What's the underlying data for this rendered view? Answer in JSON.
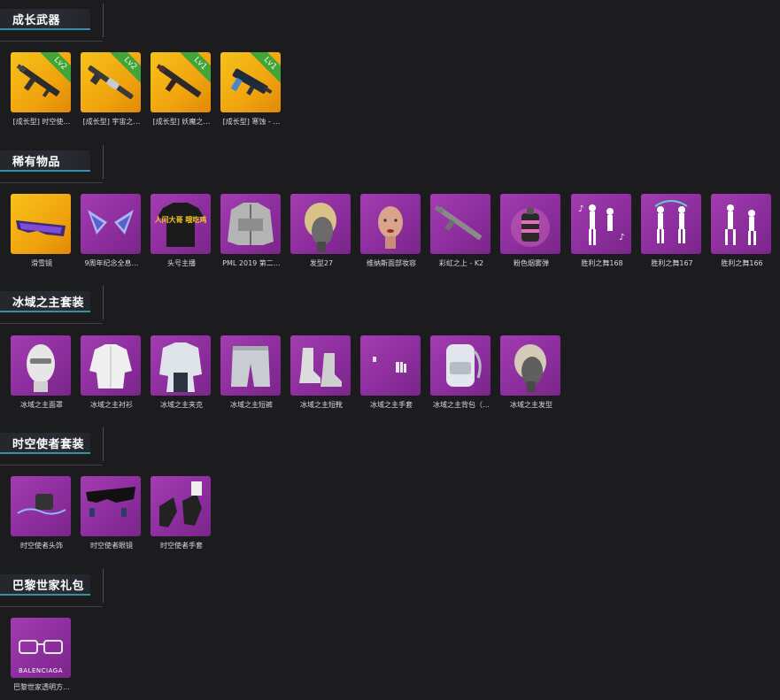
{
  "sections": [
    {
      "title": "成长武器"
    },
    {
      "title": "稀有物品"
    },
    {
      "title": "冰域之主套装"
    },
    {
      "title": "时空使者套装"
    },
    {
      "title": "巴黎世家礼包"
    }
  ],
  "growth_weapons": [
    {
      "name": "[成长型] 时空使…",
      "level": "Lv2",
      "icon": "rifle-icon"
    },
    {
      "name": "[成长型] 宇宙之…",
      "level": "Lv2",
      "icon": "shotgun-icon"
    },
    {
      "name": "[成长型] 妖魔之…",
      "level": "Lv1",
      "icon": "rifle-icon"
    },
    {
      "name": "[成长型] 寒蚀 - …",
      "level": "Lv1",
      "icon": "smg-icon"
    }
  ],
  "rare_items": [
    {
      "name": "滑雪镜",
      "icon": "goggles-icon",
      "rarity": "gold"
    },
    {
      "name": "9周年纪念全息…",
      "icon": "cat-ears-icon",
      "rarity": "purple"
    },
    {
      "name": "头号主播",
      "icon": "tshirt-icon",
      "rarity": "purple",
      "print": "人间大哥 哦吃鸡"
    },
    {
      "name": "PML 2019 第二…",
      "icon": "jacket-icon",
      "rarity": "purple"
    },
    {
      "name": "发型27",
      "icon": "hair-icon",
      "rarity": "purple"
    },
    {
      "name": "维纳斯面部妆容",
      "icon": "face-icon",
      "rarity": "purple"
    },
    {
      "name": "彩虹之上 - K2",
      "icon": "rifle-icon",
      "rarity": "purple"
    },
    {
      "name": "粉色烟雾弹",
      "icon": "grenade-icon",
      "rarity": "purple"
    },
    {
      "name": "胜利之舞168",
      "icon": "dance-icon",
      "rarity": "purple"
    },
    {
      "name": "胜利之舞167",
      "icon": "dance-icon",
      "rarity": "purple"
    },
    {
      "name": "胜利之舞166",
      "icon": "dance-icon",
      "rarity": "purple"
    }
  ],
  "ice_lord_set": [
    {
      "name": "冰域之主面罩",
      "icon": "mask-icon"
    },
    {
      "name": "冰域之主衬衫",
      "icon": "shirt-icon"
    },
    {
      "name": "冰域之主夹克",
      "icon": "coat-icon"
    },
    {
      "name": "冰域之主短裤",
      "icon": "shorts-icon"
    },
    {
      "name": "冰域之主短靴",
      "icon": "boots-icon"
    },
    {
      "name": "冰域之主手套",
      "icon": "gloves-icon"
    },
    {
      "name": "冰域之主背包（…",
      "icon": "backpack-icon"
    },
    {
      "name": "冰域之主发型",
      "icon": "hair-icon"
    }
  ],
  "time_envoy_set": [
    {
      "name": "时空使者头饰",
      "icon": "headpiece-icon"
    },
    {
      "name": "时空使者眼镜",
      "icon": "glasses-icon"
    },
    {
      "name": "时空使者手套",
      "icon": "gloves-icon"
    }
  ],
  "balenciaga_pack": [
    {
      "name": "巴黎世家透明方…",
      "icon": "sunglasses-icon",
      "brand": "BALENCIAGA"
    }
  ]
}
